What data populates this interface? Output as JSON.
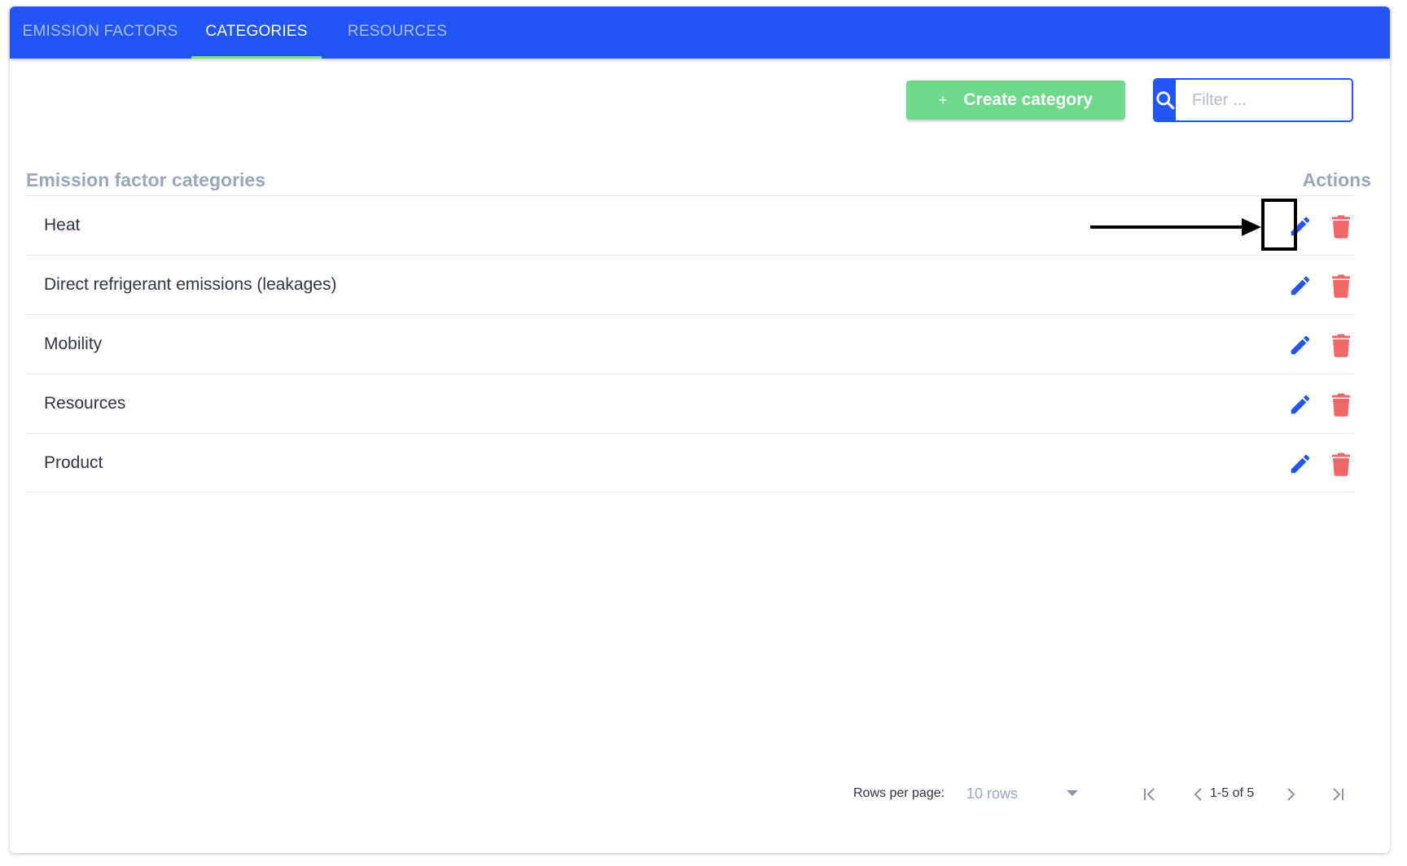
{
  "tabs": [
    {
      "label": "EMISSION FACTORS",
      "active": false
    },
    {
      "label": "CATEGORIES",
      "active": true
    },
    {
      "label": "RESOURCES",
      "active": false
    }
  ],
  "toolbar": {
    "create_icon": "+",
    "create_label": "Create category",
    "search_placeholder": "Filter ...",
    "search_icon": "search-icon"
  },
  "table": {
    "column_name": "Emission factor categories",
    "column_actions": "Actions",
    "rows": [
      {
        "name": "Heat"
      },
      {
        "name": "Direct refrigerant emissions (leakages)"
      },
      {
        "name": "Mobility"
      },
      {
        "name": "Resources"
      },
      {
        "name": "Product"
      }
    ]
  },
  "pagination": {
    "rows_per_page_label": "Rows per page:",
    "rows_per_page_value": "10 rows",
    "page_info": "1-5 of 5"
  },
  "colors": {
    "primary": "#2255f5",
    "success": "#6fd98a",
    "danger": "#f06767",
    "muted": "#9aa6bd"
  }
}
